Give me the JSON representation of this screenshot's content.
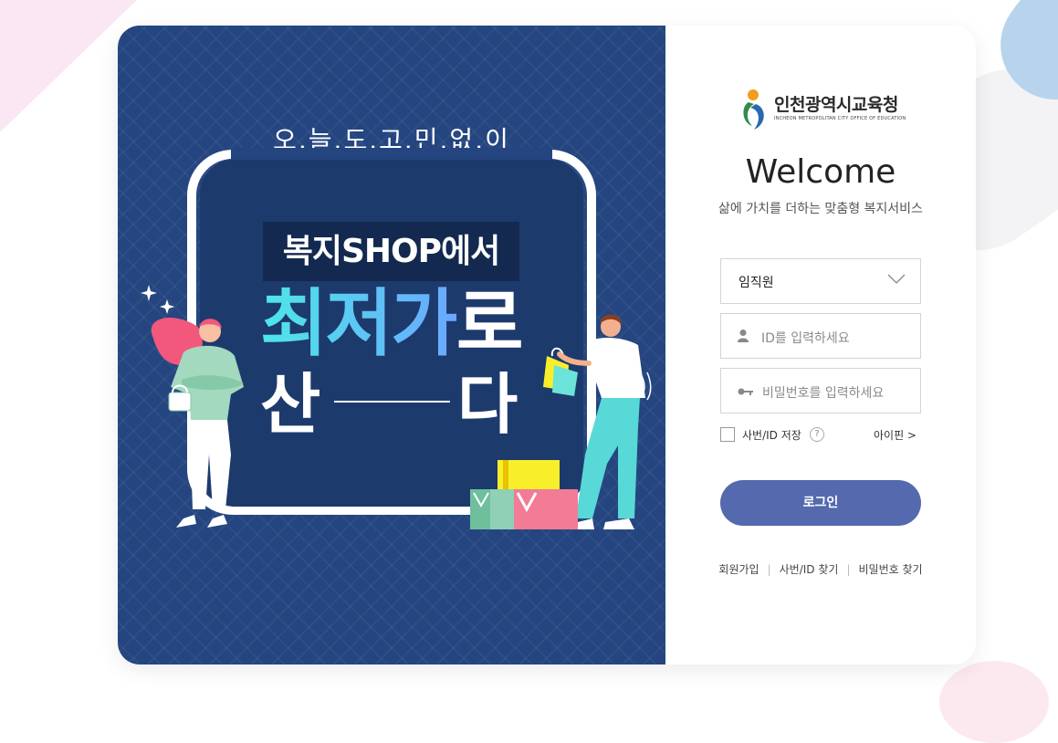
{
  "banner": {
    "slogan": "오.늘.도.고.민.없.이",
    "shop": "복지SHOP에서",
    "line1_grad": "최저가",
    "line1_white": "로",
    "line2_left": "산",
    "line2_right": "다"
  },
  "logo": {
    "name": "인천광역시교육청",
    "subtitle": "INCHEON METROPOLITAN CITY OFFICE OF EDUCATION"
  },
  "login": {
    "welcome": "Welcome",
    "subtitle": "삶에 가치를 더하는 맞춤형 복지서비스",
    "user_type": "임직원",
    "id_placeholder": "ID를 입력하세요",
    "pw_placeholder": "비밀번호를 입력하세요",
    "save_label": "사번/ID 저장",
    "help": "?",
    "ipin": "아이핀 >",
    "button": "로그인"
  },
  "links": {
    "signup": "회원가입",
    "find_id": "사번/ID 찾기",
    "find_pw": "비밀번호 찾기"
  },
  "colors": {
    "left_bg": "#24457f",
    "button": "#5469ae",
    "accent_grad_start": "#4ee7e7",
    "accent_grad_end": "#6aa8ff"
  },
  "icons": {
    "user": "user-icon",
    "key": "key-icon",
    "chevron": "chevron-down-icon"
  }
}
